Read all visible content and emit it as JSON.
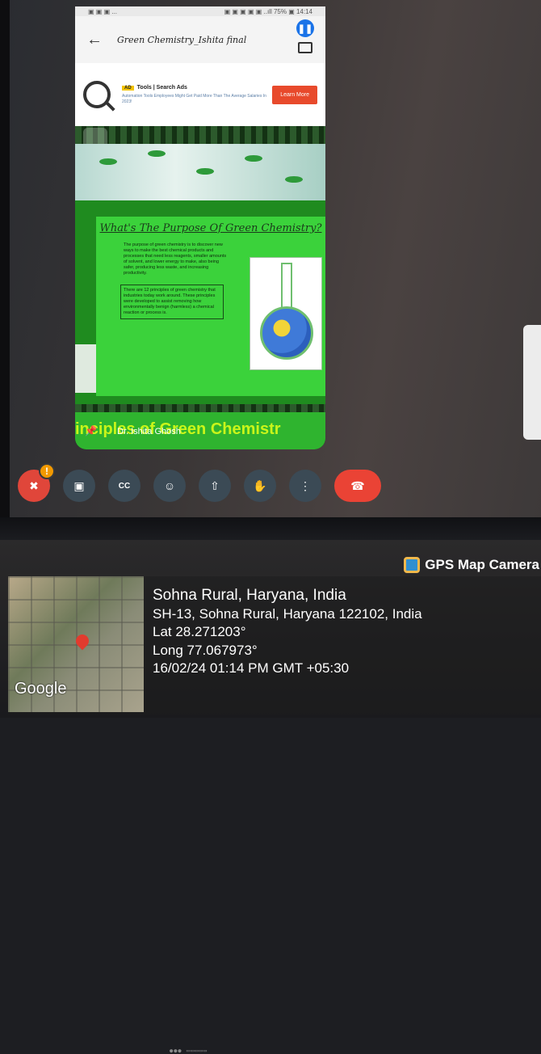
{
  "phone": {
    "status_left": "▣ ▣ ▣ ...",
    "status_right": "▣ ▣ ▣ ▣ ▣ ..ıll 75% ▣ 14:14",
    "app_title": "Green Chemistry_Ishita final"
  },
  "ad": {
    "tag": "AD",
    "headline": "Tools | Search Ads",
    "body": "Automation Tools Employees Might Get Paid More Than The Average Salaries In 2023!",
    "button": "Learn More"
  },
  "document": {
    "heading": "What's The Purpose Of Green Chemistry?",
    "paragraph": "The purpose of green chemistry is to discover new ways to make the best chemical products and processes that need less reagents, smaller amounts of solvent, and lower energy to make, also being safer, producing less waste, and increasing productivity.",
    "box_text": "There are 12 principles of green chemistry that industries today work around. These principles were developed to assist removing how environmentally benign (harmless) a chemical reaction or process is.",
    "footer_text": "inciples of Green Chemistr"
  },
  "presenter": "Dr. Ishita Ghosh",
  "controls": [
    "mic-off",
    "camera",
    "captions",
    "emoji",
    "present",
    "raise-hand",
    "more",
    "hang-up"
  ],
  "monitor_brand": "●●● ▭▭▭▭▭",
  "gps": {
    "app_label": "GPS Map Camera",
    "map_brand": "Google",
    "place": "Sohna Rural, Haryana, India",
    "address": "SH-13, Sohna Rural, Haryana 122102, India",
    "lat": "Lat 28.271203°",
    "long": "Long 77.067973°",
    "datetime": "16/02/24 01:14 PM GMT +05:30"
  },
  "colors": {
    "hangup": "#ea4335",
    "mic_off": "#e0463a",
    "control_bg": "#3b4a55",
    "doc_green": "#3bd23b",
    "ad_button": "#e84a2c"
  }
}
